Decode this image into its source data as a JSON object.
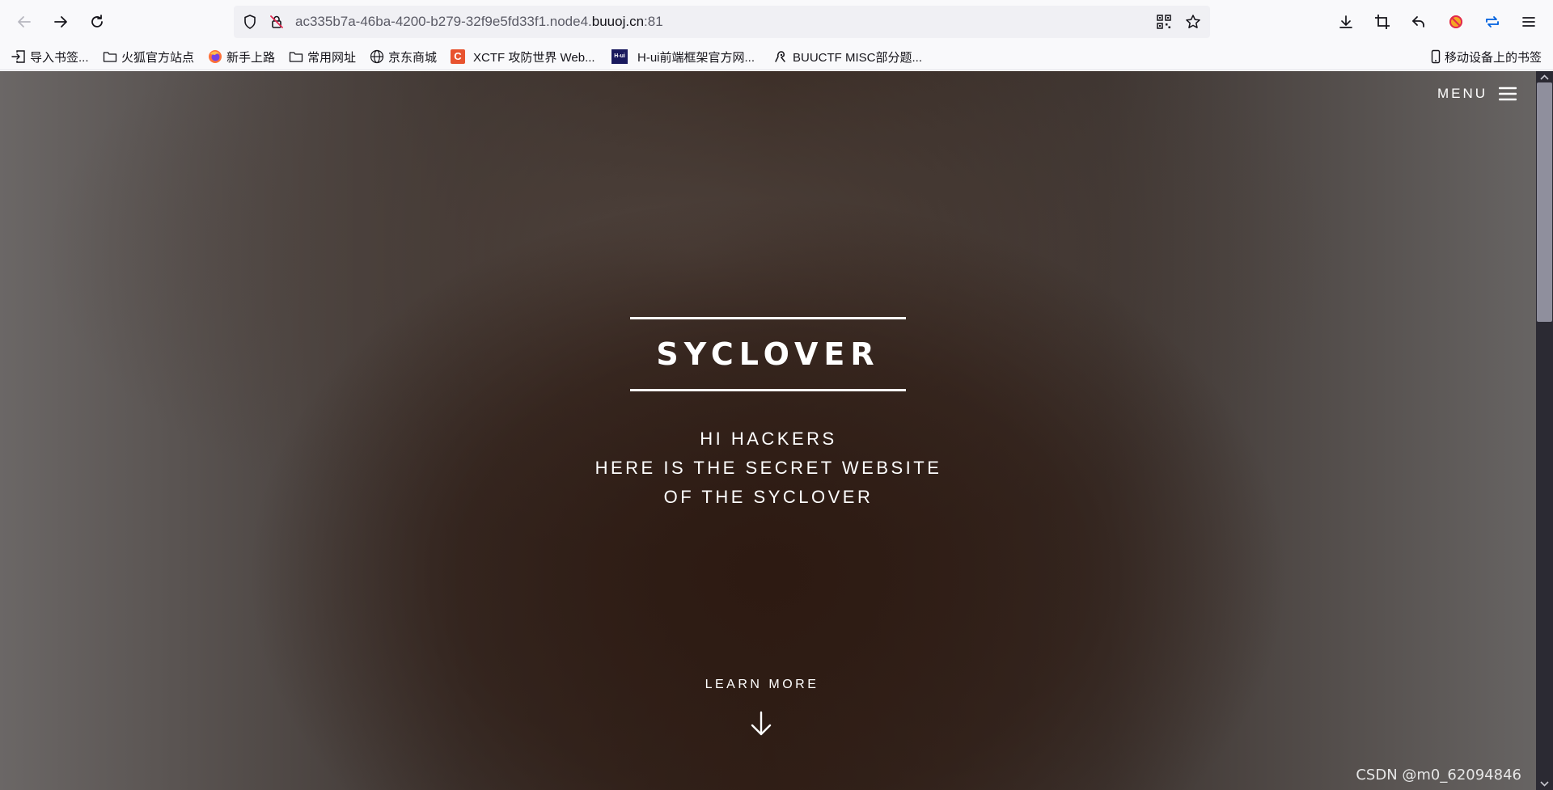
{
  "browser": {
    "url_prefix": "ac335b7a-46ba-4200-b279-32f9e5fd33f1.node4.",
    "url_host": "buuoj.cn",
    "url_suffix": ":81"
  },
  "bookmarks": {
    "items": [
      {
        "label": "导入书签...",
        "icon": "import-icon"
      },
      {
        "label": "火狐官方站点",
        "icon": "folder-icon"
      },
      {
        "label": "新手上路",
        "icon": "firefox-icon"
      },
      {
        "label": "常用网址",
        "icon": "folder-icon"
      },
      {
        "label": "京东商城",
        "icon": "globe-icon"
      },
      {
        "label": "XCTF 攻防世界 Web...",
        "icon": "xctf-icon"
      },
      {
        "label": "H-ui前端框架官方网...",
        "icon": "hui-icon"
      },
      {
        "label": "BUUCTF MISC部分题...",
        "icon": "buuctf-icon"
      }
    ],
    "mobile": "移动设备上的书签",
    "xctf_badge": "C",
    "hui_badge": "H-ui"
  },
  "page": {
    "menu_label": "MENU",
    "title": "SYCLOVER",
    "subtitle_lines": [
      "HI HACKERS",
      "HERE IS THE SECRET WEBSITE",
      "OF THE SYCLOVER"
    ],
    "learn_more": "LEARN MORE"
  },
  "watermark": "CSDN @m0_62094846",
  "colors": {
    "accent": "#ffffff",
    "browser_bg": "#f9f9fb",
    "urlbar_bg": "#f0f0f4",
    "sync_icon": "#0060df",
    "addon_icon": "#e22850"
  }
}
